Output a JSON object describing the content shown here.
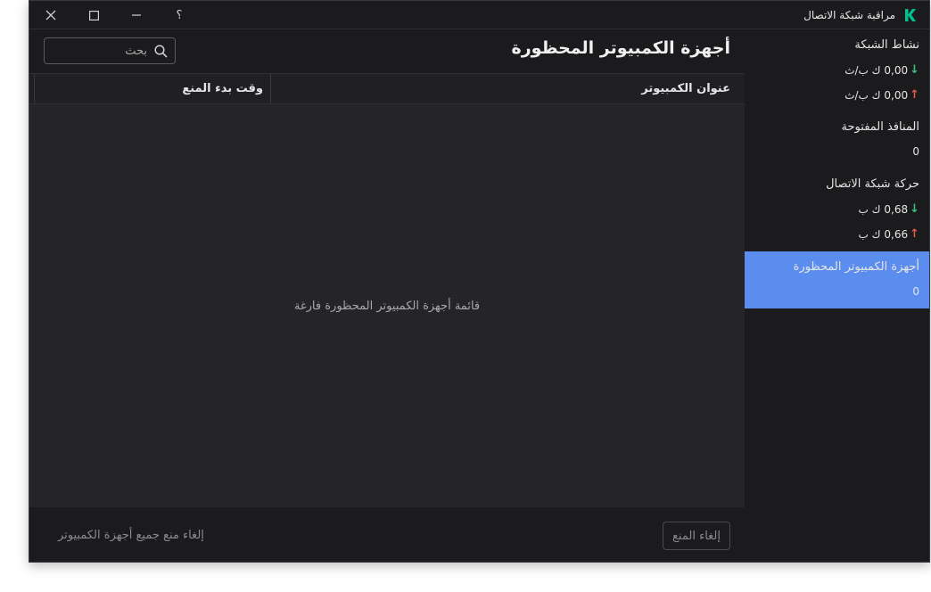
{
  "window": {
    "app_title": "مراقبة شبكة الاتصال",
    "help_label": "؟"
  },
  "sidebar": {
    "network_activity": {
      "label": "نشاط الشبكة",
      "download": "0,00 ك ب/ث",
      "upload": "0,00 ك ب/ث"
    },
    "open_ports": {
      "label": "المنافذ المفتوحة",
      "value": "0"
    },
    "network_traffic": {
      "label": "حركة شبكة الاتصال",
      "download": "0,68 ك ب",
      "upload": "0,66 ك ب"
    },
    "blocked_computers": {
      "label": "أجهزة الكمبيوتر المحظورة",
      "value": "0"
    }
  },
  "main": {
    "title": "أجهزة الكمبيوتر المحظورة",
    "search_placeholder": "بحث",
    "columns": {
      "computer_address": "عنوان الكمبيوتر",
      "block_start_time": "وقت بدء المنع"
    },
    "empty_message": "قائمة أجهزة الكمبيوتر المحظورة فارغة",
    "unblock_button": "إلغاء المنع",
    "unblock_all_link": "إلغاء منع جميع أجهزة الكمبيوتر"
  },
  "colors": {
    "accent": "#5b8def",
    "logo": "#00c28e",
    "download_arrow": "#3fbf7f",
    "upload_arrow": "#e05a4f"
  }
}
